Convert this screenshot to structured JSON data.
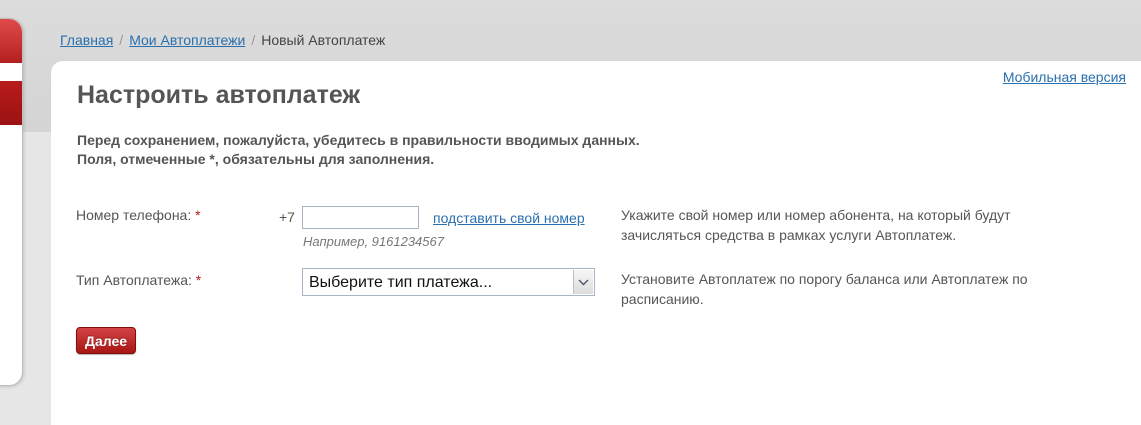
{
  "breadcrumb": {
    "home": "Главная",
    "my_autopayments": "Мои Автоплатежи",
    "current": "Новый Автоплатеж",
    "separator": "/"
  },
  "mobile_version_link": "Мобильная версия",
  "page_title": "Настроить автоплатеж",
  "intro": {
    "line1": "Перед сохранением, пожалуйста, убедитесь в правильности вводимых данных.",
    "line2": "Поля, отмеченные *, обязательны для заполнения."
  },
  "form": {
    "phone": {
      "label": "Номер телефона:",
      "required_mark": "*",
      "prefix": "+7",
      "value": "",
      "insert_own_link": "подставить свой номер",
      "example": "Например, 9161234567",
      "hint_line1": "Укажите свой номер или номер абонента, на который будут",
      "hint_line2": "зачисляться средства в рамках услуги Автоплатеж."
    },
    "type": {
      "label": "Тип Автоплатежа:",
      "required_mark": "*",
      "selected": "Выберите тип платежа...",
      "hint_line1": "Установите Автоплатеж по порогу баланса или Автоплатеж по",
      "hint_line2": "расписанию."
    }
  },
  "next_button": "Далее",
  "colors": {
    "accent_red": "#b31b1b",
    "link_blue": "#2a6fae",
    "text_gray": "#555555"
  }
}
